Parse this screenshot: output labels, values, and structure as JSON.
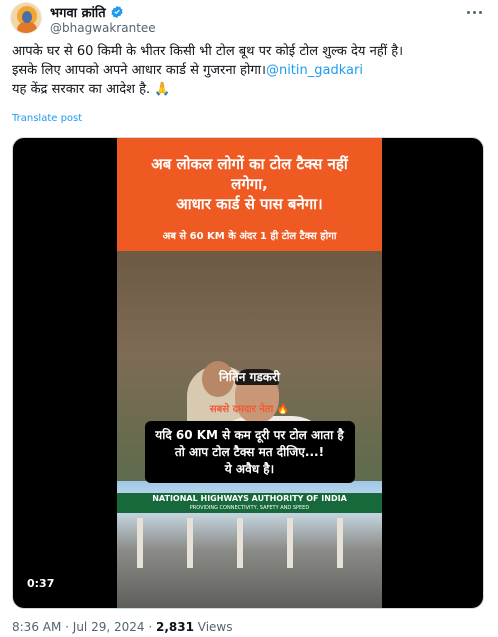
{
  "author": {
    "display_name": "भगवा क्रांति",
    "handle": "@bhagwakrantee",
    "verified": true
  },
  "tweet": {
    "lines": [
      "आपके घर से 60 किमी के भीतर किसी भी टोल बूथ पर कोई टोल शुल्क देय नहीं है।",
      "इसके लिए आपको अपने आधार कार्ड से गुजरना होगा।",
      " यह केंद्र सरकार का आदेश है.   🙏"
    ],
    "mention": "@nitin_gadkari",
    "translate_label": "Translate post"
  },
  "video": {
    "banner_line1": "अब लोकल लोगों का टोल टैक्स नहीं",
    "banner_line2": "लगेगा,",
    "banner_line3": "आधार कार्ड से पास बनेगा।",
    "banner_sub": "अब से 60 KM के अंदर 1 ही टोल टैक्स होगा",
    "name_caption": "नितिन गडकरी",
    "tag_caption": "सबसे दमदार नेता 🔥",
    "main_line1": "यदि 60 KM से कम दूरी पर टोल आता है",
    "main_line2": "तो आप टोल टैक्स मत दीजिए...!",
    "main_line3": "ये अवैध है।",
    "nhai_title": "NATIONAL HIGHWAYS AUTHORITY OF INDIA",
    "nhai_sub": "PROVIDING CONNECTIVITY, SAFETY AND SPEED",
    "duration": "0:37"
  },
  "meta": {
    "time": "8:36 AM",
    "sep1": " · ",
    "date": "Jul 29, 2024",
    "sep2": " · ",
    "views": "2,831",
    "views_label": " Views"
  },
  "colors": {
    "accent": "#1d9bf0",
    "banner": "#ef5a22",
    "nhai_green": "#17683b"
  }
}
